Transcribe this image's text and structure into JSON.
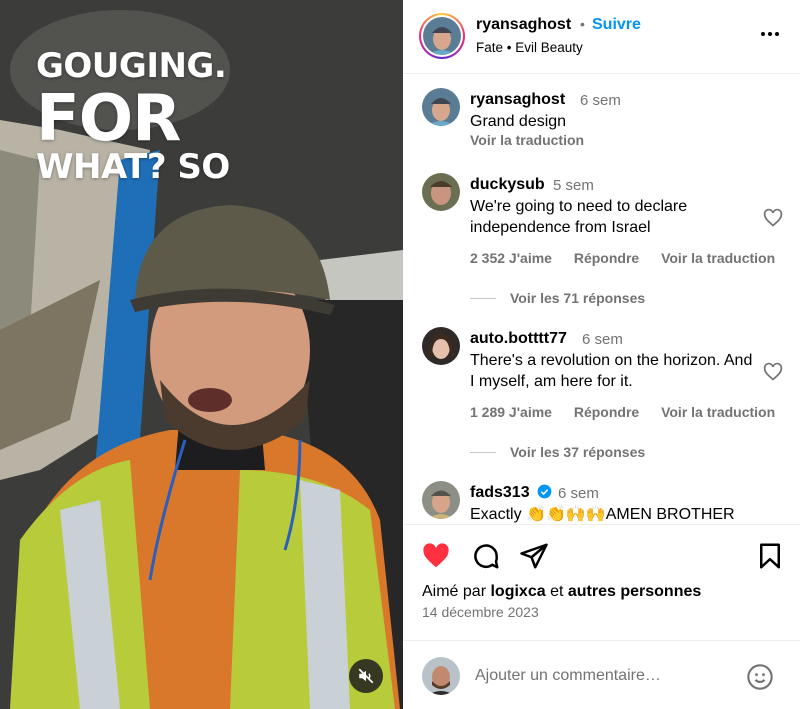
{
  "video": {
    "overlay_lines": [
      "GOUGING.",
      "FOR",
      "WHAT? SO"
    ],
    "mute_icon": "speaker-muted-icon"
  },
  "post": {
    "username": "ryansaghost",
    "separator": "•",
    "follow_label": "Suivre",
    "audio": "Fate • Evil Beauty",
    "more_icon": "more-horizontal-icon"
  },
  "caption": {
    "username": "ryansaghost",
    "time": "6 sem",
    "text": "Grand design",
    "translate": "Voir la traduction"
  },
  "comments": [
    {
      "username": "duckysub",
      "time": "5 sem",
      "text": "We're going to need to declare independence from Israel",
      "likes": "2 352 J'aime",
      "reply": "Répondre",
      "translate": "Voir la traduction",
      "replies": "Voir les 71 réponses"
    },
    {
      "username": "auto.botttt77",
      "time": "6 sem",
      "text": "There's a revolution on the horizon. And I myself, am here for it.",
      "likes": "1 289 J'aime",
      "reply": "Répondre",
      "translate": "Voir la traduction",
      "replies": "Voir les 37 réponses"
    },
    {
      "username": "fads313",
      "time": "6 sem",
      "verified": true,
      "text": "Exactly 👏👏🙌🙌AMEN BROTHER"
    }
  ],
  "actions": {
    "like_icon": "heart-filled-icon",
    "comment_icon": "comment-icon",
    "share_icon": "paper-plane-icon",
    "save_icon": "bookmark-icon",
    "like_color": "#ff3040",
    "liked_prefix": "Aimé par",
    "liked_user": "logixca",
    "liked_mid": "et",
    "liked_others": "autres personnes",
    "date": "14 décembre 2023"
  },
  "composer": {
    "placeholder": "Ajouter un commentaire…",
    "emoji_icon": "emoji-smiley-icon"
  },
  "colors": {
    "link_blue": "#0095f6",
    "secondary_text": "#737373",
    "like_red": "#ff3040"
  }
}
